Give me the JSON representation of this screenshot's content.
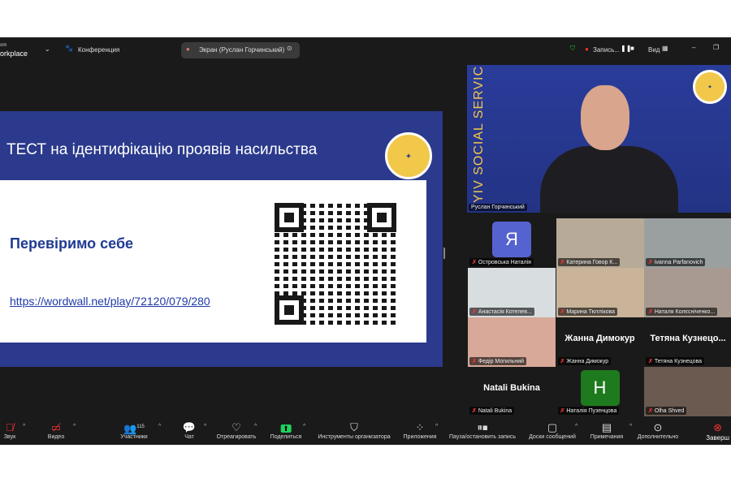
{
  "topbar": {
    "brand_small": "om",
    "brand": "orkplace",
    "meeting_label": "Конференция",
    "share_label": "Экран (Руслан Горчинський)",
    "record_label": "Запись...",
    "view_label": "Вид"
  },
  "slide": {
    "title": "ТЕСТ на ідентифікацію проявів насильства",
    "heading": "Перевіримо себе",
    "link": "https://wordwall.net/play/72120/079/280"
  },
  "speaker": {
    "name": "Руслан Горчинський",
    "banner": "YIV SOCIAL SERVICES"
  },
  "participants": [
    {
      "name": "Островська Наталія",
      "avatar": "Я",
      "color": "#5563d0"
    },
    {
      "name": "Катерина Говор К...",
      "color": "#b8aa98"
    },
    {
      "name": "ivanna Parfanovich",
      "color": "#9aa0a0"
    },
    {
      "name": "Анастасія Котелев...",
      "color": "#d8dde0"
    },
    {
      "name": "Марина Тютлікова",
      "color": "#c9b49a"
    },
    {
      "name": "Наталя Колєсніченко...",
      "color": "#a89a90"
    },
    {
      "name": "Федір Могильний",
      "color": "#d8a898"
    },
    {
      "name": "Жанна Димокур",
      "big": "Жанна Димокур"
    },
    {
      "name": "Тетяна Кузнецова",
      "big": "Тетяна  Кузнецо..."
    },
    {
      "name": "Natali Bukina",
      "big": "Natali Bukina"
    },
    {
      "name": "Наталія Пузенцова",
      "avatar": "H",
      "color": "#1e7a1e"
    },
    {
      "name": "Olha Shved",
      "color": "#6a5a50"
    }
  ],
  "toolbar": {
    "audio": "Звук",
    "video": "Видео",
    "participants": "Участники",
    "participants_count": "115",
    "chat": "Чат",
    "react": "Отреагировать",
    "share": "Поделиться",
    "host_tools": "Инструменты организатора",
    "apps": "Приложения",
    "pause_record": "Пауза/остановить запись",
    "whiteboards": "Доски сообщений",
    "notes": "Примечания",
    "more": "Дополнительно",
    "end": "Заверш"
  }
}
